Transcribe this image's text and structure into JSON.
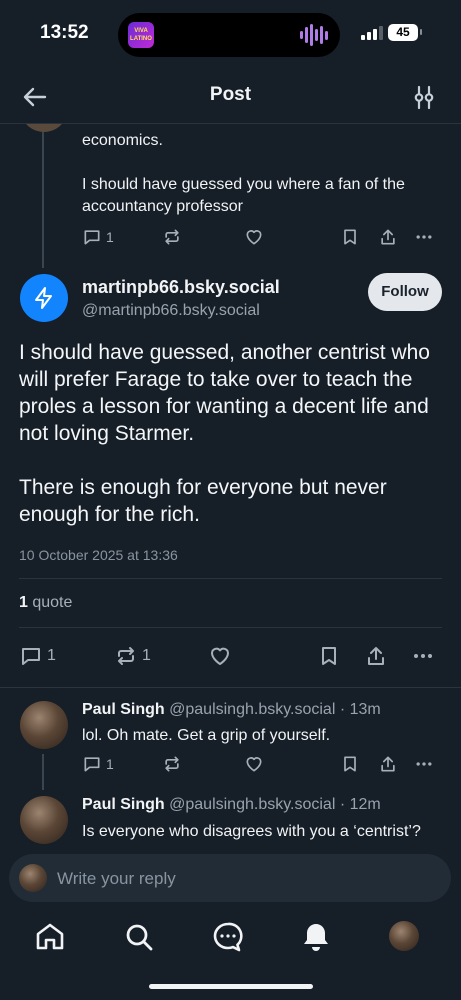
{
  "status_bar": {
    "time": "13:52",
    "battery": "45",
    "now_playing_thumb": "VIVA LATINO"
  },
  "header": {
    "title": "Post",
    "back_icon": "arrow-left-icon",
    "filter_icon": "sliders-icon"
  },
  "parent_post": {
    "text_lines": [
      "economics.",
      "I should have guessed you where a fan of the accountancy professor"
    ],
    "reply_count": "1"
  },
  "main_post": {
    "display_name": "martinpb66.bsky.social",
    "handle": "@martinpb66.bsky.social",
    "follow_label": "Follow",
    "paragraphs": [
      "I should have guessed, another centrist who will prefer Farage to take over to teach the proles a lesson for wanting  a decent life and not loving Starmer.",
      "There is enough for everyone but never enough for the rich."
    ],
    "timestamp": "10 October 2025 at 13:36",
    "quote_count": "1",
    "quote_label": "quote",
    "reply_count": "1",
    "repost_count": "1"
  },
  "replies": [
    {
      "name": "Paul Singh",
      "handle": "@paulsingh.bsky.social",
      "age": "· 13m",
      "text": "lol. Oh mate. Get a grip of yourself.",
      "reply_count": "1"
    },
    {
      "name": "Paul Singh",
      "handle": "@paulsingh.bsky.social",
      "age": "· 12m",
      "text": "Is everyone who disagrees with you a ‘centrist’?"
    }
  ],
  "reply_composer": {
    "placeholder": "Write your reply"
  },
  "tabbar": {
    "items": [
      "home-icon",
      "search-icon",
      "chat-icon",
      "bell-icon",
      "profile-avatar"
    ]
  },
  "colors": {
    "background": "#161e27",
    "accent": "#1285fe",
    "muted": "#a6b0bb"
  }
}
